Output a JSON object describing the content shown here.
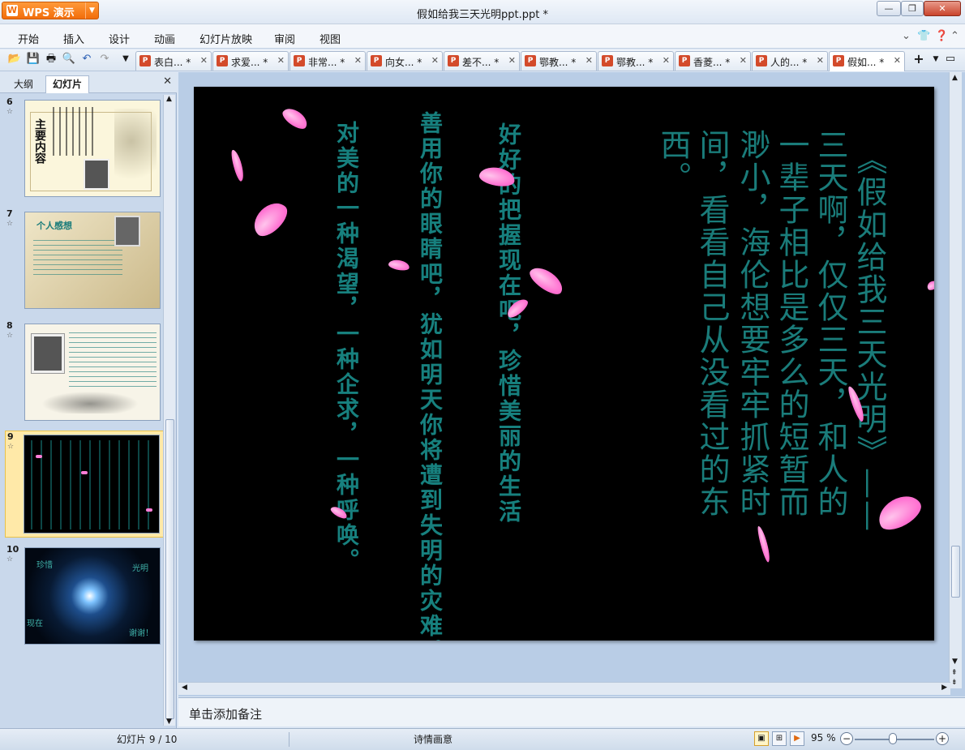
{
  "app": {
    "brand": "WPS 演示",
    "window_title": "假如给我三天光明ppt.ppt *"
  },
  "menu": [
    "开始",
    "插入",
    "设计",
    "动画",
    "幻灯片放映",
    "审阅",
    "视图"
  ],
  "doc_tabs": [
    "表白... *",
    "求爱... *",
    "非常... *",
    "向女... *",
    "差不... *",
    "鄂教... *",
    "鄂教... *",
    "香菱... *",
    "人的... *",
    "假如... *"
  ],
  "active_tab_index": 9,
  "left_panel": {
    "tabs": [
      "大纲",
      "幻灯片"
    ],
    "active_tab": "幻灯片",
    "slides": [
      {
        "num": "6",
        "star": "☆",
        "title": "主要内容"
      },
      {
        "num": "7",
        "star": "☆",
        "title": "个人感想"
      },
      {
        "num": "8",
        "star": "☆",
        "title": ""
      },
      {
        "num": "9",
        "star": "☆",
        "title": ""
      },
      {
        "num": "10",
        "star": "☆",
        "labels": [
          "珍惜",
          "光明",
          "现在",
          "谢谢！"
        ]
      }
    ],
    "selected_slide": "9"
  },
  "slide": {
    "col1": "对美的一种渴望，一种企求，一种呼唤。",
    "col2": "善用你的眼睛吧，犹如明天你将遭到失明的灾难。",
    "col3": "好好的把握现在吧，珍惜美丽的生活",
    "col4": "《假如给我三天光明》——",
    "col5": "三天啊，仅仅三天，和人的",
    "col6": "一辈子相比是多么的短暂而",
    "col7": "渺小，海伦想要牢牢抓紧时",
    "col8": "间，看看自己从没看过的东",
    "col9": "西。",
    "text_color": "#17807e"
  },
  "notes_placeholder": "单击添加备注",
  "status": {
    "slide_counter": "幻灯片 9 / 10",
    "theme": "诗情画意",
    "zoom": "95 %"
  }
}
